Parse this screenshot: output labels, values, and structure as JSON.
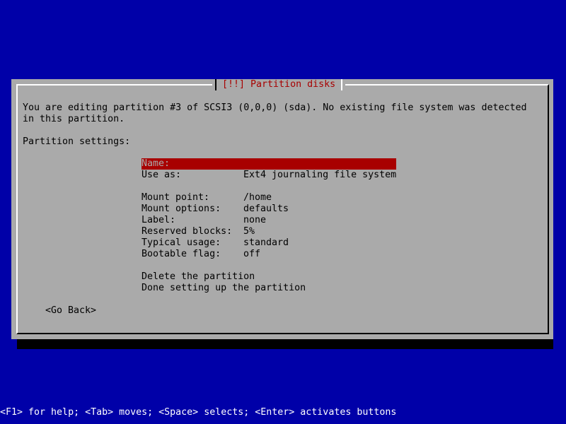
{
  "dialog": {
    "title": "[!!] Partition disks",
    "message_line1": "You are editing partition #3 of SCSI3 (0,0,0) (sda). No existing file system was detected",
    "message_line2": "in this partition.",
    "settings_heading": "Partition settings:"
  },
  "settings": [
    {
      "key": "Name:",
      "value": ""
    },
    {
      "key": "Use as:",
      "value": "Ext4 journaling file system"
    },
    {
      "key": "Mount point:",
      "value": "/home"
    },
    {
      "key": "Mount options:",
      "value": "defaults"
    },
    {
      "key": "Label:",
      "value": "none"
    },
    {
      "key": "Reserved blocks:",
      "value": "5%"
    },
    {
      "key": "Typical usage:",
      "value": "standard"
    },
    {
      "key": "Bootable flag:",
      "value": "off"
    }
  ],
  "actions": {
    "delete": "Delete the partition",
    "done": "Done setting up the partition"
  },
  "buttons": {
    "go_back": "<Go Back>"
  },
  "footer": {
    "help": "<F1> for help; <Tab> moves; <Space> selects; <Enter> activates buttons"
  },
  "colors": {
    "background": "#0000a8",
    "dialog": "#aaaaaa",
    "title": "#a80000",
    "selection": "#a80000"
  }
}
